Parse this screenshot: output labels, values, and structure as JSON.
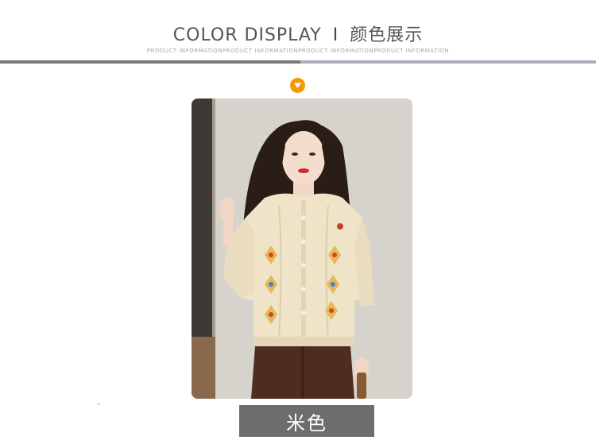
{
  "header": {
    "title_en": "COLOR DISPLAY",
    "separator": "I",
    "title_cn": "颜色展示",
    "subtitle": "PRODUCT INFORMATIONPRODUCT INFORMATIONPRODUCT INFORMATIONPRODUCT INFORMATION"
  },
  "marker_icon": "chevron-down-icon",
  "product": {
    "photo_subject": "model-wearing-cream-embroidered-cardigan",
    "color_label": "米色"
  },
  "stray_mark": "`",
  "colors": {
    "accent": "#f39a00",
    "divider_dark": "#7a7a7a",
    "divider_light": "#a9afb9",
    "label_bg": "#6d6d6d",
    "cardigan": "#efe3c8",
    "pants": "#4e2d1e"
  }
}
